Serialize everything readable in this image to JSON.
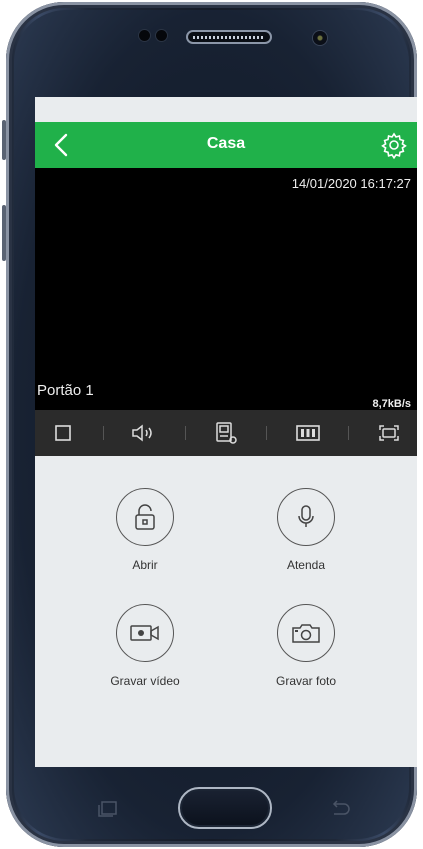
{
  "app": {
    "title": "Casa"
  },
  "video": {
    "timestamp": "14/01/2020 16:17:27",
    "camera_name": "Portão 1",
    "bitrate": "8,7kB/s"
  },
  "toolbar": {
    "icons": [
      "stop-icon",
      "speaker-icon",
      "intercom-icon",
      "stream-quality-icon",
      "fullscreen-icon"
    ]
  },
  "actions": {
    "open_label": "Abrir",
    "answer_label": "Atenda",
    "record_video_label": "Gravar vídeo",
    "record_photo_label": "Gravar foto"
  },
  "colors": {
    "accent": "#20b14a",
    "video_bg": "#000000",
    "toolbar_bg": "#2b2b2b",
    "screen_bg": "#e9ecee"
  }
}
